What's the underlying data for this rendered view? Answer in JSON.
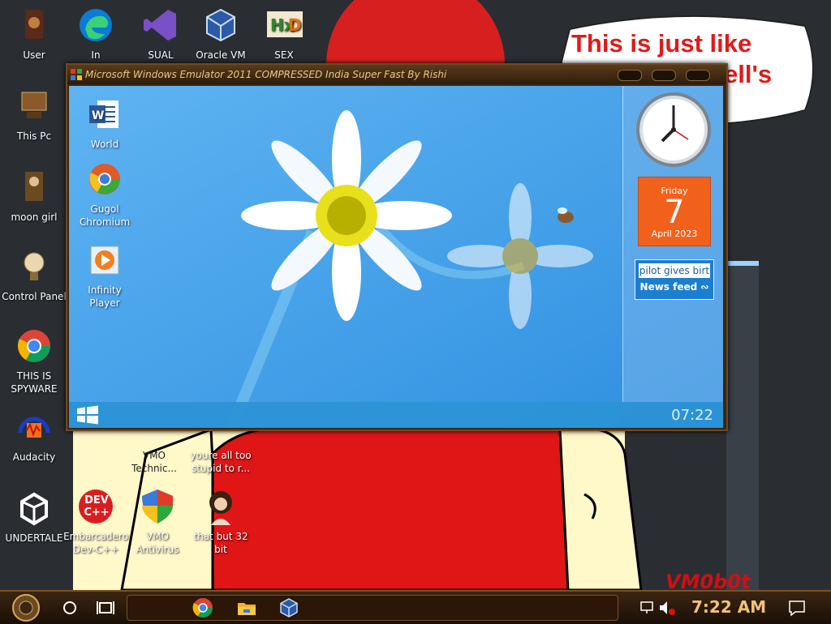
{
  "desktop": {
    "icons_left": [
      {
        "label": "User",
        "icon": "user-icon"
      },
      {
        "label": "This Pc",
        "icon": "this-pc-icon"
      },
      {
        "label": "moon girl",
        "icon": "moon-girl-icon"
      },
      {
        "label": "Control Panel",
        "icon": "control-panel-icon"
      },
      {
        "label": "THIS IS SPYWARE",
        "icon": "chrome-icon"
      },
      {
        "label": "Audacity",
        "icon": "audacity-icon"
      },
      {
        "label": "UNDERTALE",
        "icon": "unity-icon"
      }
    ],
    "icons_top": [
      {
        "label": "In",
        "icon": "edge-icon"
      },
      {
        "label": "SUAL",
        "icon": "visual-studio-icon"
      },
      {
        "label": "Oracle VM",
        "icon": "virtualbox-icon"
      },
      {
        "label": "SEX",
        "icon": "hxd-icon"
      }
    ],
    "icons_bottom": [
      {
        "label": "VMO Technic...",
        "icon": "vmo-icon"
      },
      {
        "label": "youre all too stupid to r...",
        "icon": "file-icon"
      },
      {
        "label": "Embarcadero Dev-C++",
        "icon": "devcpp-icon",
        "badge": "DEV C++"
      },
      {
        "label": "VMO Antivirus",
        "icon": "shield-icon"
      },
      {
        "label": "that but 32 bit",
        "icon": "portrait-icon"
      }
    ],
    "watermark": "VM0b0t",
    "speech_bubble": {
      "line1": "This is just like",
      "line2": "ell's"
    }
  },
  "emulator": {
    "title": "Microsoft Windows Emulator 2011 COMPRESSED India Super Fast By Rishi",
    "icons": [
      {
        "label": "World",
        "icon": "word-icon"
      },
      {
        "label": "Gugol Chromium",
        "icon": "chromium-icon"
      },
      {
        "label": "Infinity Player",
        "icon": "media-player-icon"
      }
    ],
    "calendar": {
      "day_name": "Friday",
      "day": "7",
      "month_year": "April 2023"
    },
    "news": {
      "ticker": "pilot gives birt",
      "label": "News feed"
    },
    "clock_time": "07:22"
  },
  "taskbar": {
    "time": "7:22 AM",
    "items": [
      "start-orb",
      "cortana-circle",
      "task-view",
      "chrome",
      "file-explorer",
      "virtualbox"
    ]
  },
  "colors": {
    "sky": "#4aa6ee",
    "orange": "#f2611b",
    "taskbar_gold": "#f2c27a",
    "red_shirt": "#e01515"
  }
}
